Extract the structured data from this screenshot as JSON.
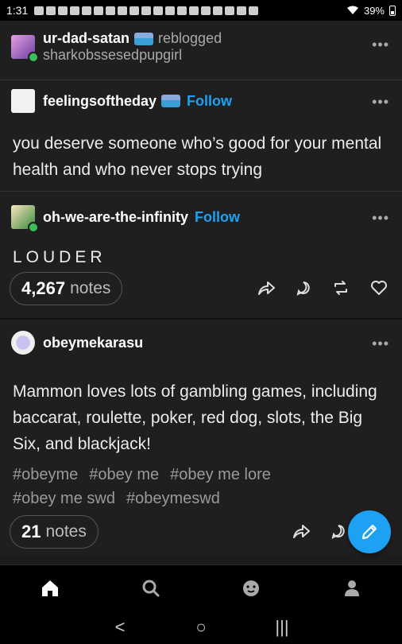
{
  "status_bar": {
    "time": "1:31",
    "battery": "39%"
  },
  "post1": {
    "reblogger": {
      "username": "ur-dad-satan",
      "action": "reblogged",
      "source": "sharkobssesedpupgirl",
      "avatar_icon": "user-avatar-icon"
    },
    "thread": [
      {
        "username": "feelingsoftheday",
        "follow_label": "Follow",
        "body": "you deserve someone who’s good for your mental health and who never stops trying"
      },
      {
        "username": "oh-we-are-the-infinity",
        "follow_label": "Follow",
        "body": "LOUDER"
      }
    ],
    "notes_count": "4,267",
    "notes_label": "notes"
  },
  "post2": {
    "username": "obeymekarasu",
    "body": "Mammon loves lots of gambling games, including baccarat, roulette, poker, red dog, slots, the Big Six, and blackjack!",
    "tags": [
      "#obeyme",
      "#obey me",
      "#obey me lore",
      "#obey me swd",
      "#obeymeswd"
    ],
    "notes_count": "21",
    "notes_label": "notes"
  },
  "more_label": "•••",
  "colors": {
    "accent": "#1da1f2",
    "background": "#1f1f1f",
    "badge": "#3bbd5a"
  },
  "tabs": [
    "home-icon",
    "search-icon",
    "activity-icon",
    "account-icon"
  ],
  "nav": {
    "back": "<",
    "home": "○",
    "recents": "|||"
  }
}
